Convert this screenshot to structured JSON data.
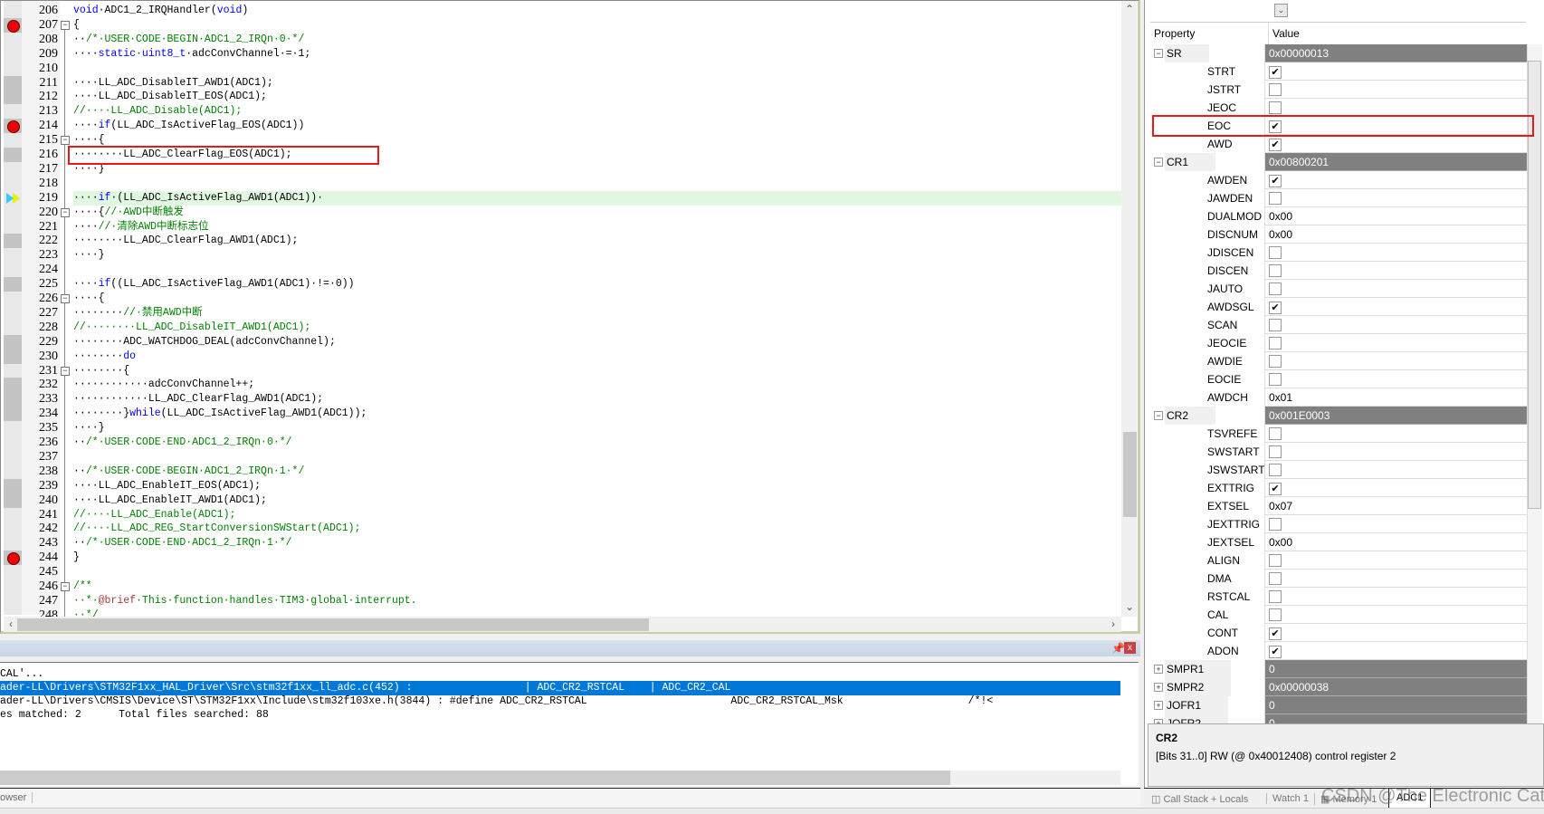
{
  "editor": {
    "current_line": 219,
    "lines": [
      {
        "n": "206",
        "mk": "",
        "fold": "",
        "seg": [
          [
            "k",
            "void"
          ],
          [
            "p",
            "·ADC1_2_IRQHandler("
          ],
          [
            "k",
            "void"
          ],
          [
            "p",
            ")"
          ]
        ]
      },
      {
        "n": "207",
        "mk": "bp",
        "fold": "minus",
        "seg": [
          [
            "p",
            "{"
          ]
        ]
      },
      {
        "n": "208",
        "mk": "",
        "fold": "",
        "seg": [
          [
            "p",
            "··"
          ],
          [
            "c",
            "/*·USER·CODE·BEGIN·ADC1_2_IRQn·0·*/"
          ]
        ]
      },
      {
        "n": "209",
        "mk": "",
        "fold": "",
        "seg": [
          [
            "p",
            "····"
          ],
          [
            "k",
            "static·uint8_t"
          ],
          [
            "p",
            "·adcConvChannel·=·1;"
          ]
        ]
      },
      {
        "n": "210",
        "mk": "",
        "fold": "",
        "seg": []
      },
      {
        "n": "211",
        "mk": "exec",
        "fold": "",
        "seg": [
          [
            "p",
            "····LL_ADC_DisableIT_AWD1(ADC1);"
          ]
        ]
      },
      {
        "n": "212",
        "mk": "exec",
        "fold": "",
        "seg": [
          [
            "p",
            "····LL_ADC_DisableIT_EOS(ADC1);"
          ]
        ]
      },
      {
        "n": "213",
        "mk": "",
        "fold": "",
        "seg": [
          [
            "c",
            "//····LL_ADC_Disable(ADC1);"
          ]
        ]
      },
      {
        "n": "214",
        "mk": "bp",
        "fold": "",
        "seg": [
          [
            "p",
            "····"
          ],
          [
            "k",
            "if"
          ],
          [
            "p",
            "(LL_ADC_IsActiveFlag_EOS(ADC1))"
          ]
        ]
      },
      {
        "n": "215",
        "mk": "",
        "fold": "minus",
        "seg": [
          [
            "p",
            "····{"
          ]
        ]
      },
      {
        "n": "216",
        "mk": "exec",
        "fold": "",
        "seg": [
          [
            "p",
            "········LL_ADC_ClearFlag_EOS(ADC1);"
          ]
        ]
      },
      {
        "n": "217",
        "mk": "",
        "fold": "",
        "seg": [
          [
            "p",
            "····}"
          ]
        ]
      },
      {
        "n": "218",
        "mk": "",
        "fold": "",
        "seg": []
      },
      {
        "n": "219",
        "mk": "cur",
        "fold": "",
        "seg": [
          [
            "p",
            "····"
          ],
          [
            "k",
            "if"
          ],
          [
            "p",
            "·(LL_ADC_IsActiveFlag_AWD1(ADC1))·"
          ]
        ]
      },
      {
        "n": "220",
        "mk": "",
        "fold": "minus",
        "seg": [
          [
            "p",
            "····{"
          ],
          [
            "c",
            "//·AWD中断触发"
          ]
        ]
      },
      {
        "n": "221",
        "mk": "",
        "fold": "",
        "seg": [
          [
            "p",
            "····"
          ],
          [
            "c",
            "//·清除AWD中断标志位"
          ]
        ]
      },
      {
        "n": "222",
        "mk": "exec",
        "fold": "",
        "seg": [
          [
            "p",
            "········LL_ADC_ClearFlag_AWD1(ADC1);"
          ]
        ]
      },
      {
        "n": "223",
        "mk": "",
        "fold": "",
        "seg": [
          [
            "p",
            "····}"
          ]
        ]
      },
      {
        "n": "224",
        "mk": "",
        "fold": "",
        "seg": []
      },
      {
        "n": "225",
        "mk": "exec",
        "fold": "",
        "seg": [
          [
            "p",
            "····"
          ],
          [
            "k",
            "if"
          ],
          [
            "p",
            "((LL_ADC_IsActiveFlag_AWD1(ADC1)·!=·0))"
          ]
        ]
      },
      {
        "n": "226",
        "mk": "",
        "fold": "minus",
        "seg": [
          [
            "p",
            "····{"
          ]
        ]
      },
      {
        "n": "227",
        "mk": "",
        "fold": "",
        "seg": [
          [
            "p",
            "········"
          ],
          [
            "c",
            "//·禁用AWD中断"
          ]
        ]
      },
      {
        "n": "228",
        "mk": "",
        "fold": "",
        "seg": [
          [
            "c",
            "//········LL_ADC_DisableIT_AWD1(ADC1);"
          ]
        ]
      },
      {
        "n": "229",
        "mk": "exec",
        "fold": "",
        "seg": [
          [
            "p",
            "········ADC_WATCHDOG_DEAL(adcConvChannel);"
          ]
        ]
      },
      {
        "n": "230",
        "mk": "exec",
        "fold": "",
        "seg": [
          [
            "p",
            "········"
          ],
          [
            "k",
            "do"
          ]
        ]
      },
      {
        "n": "231",
        "mk": "",
        "fold": "minus",
        "seg": [
          [
            "p",
            "········{"
          ]
        ]
      },
      {
        "n": "232",
        "mk": "exec",
        "fold": "",
        "seg": [
          [
            "p",
            "············adcConvChannel++;"
          ]
        ]
      },
      {
        "n": "233",
        "mk": "exec",
        "fold": "",
        "seg": [
          [
            "p",
            "············LL_ADC_ClearFlag_AWD1(ADC1);"
          ]
        ]
      },
      {
        "n": "234",
        "mk": "exec",
        "fold": "",
        "seg": [
          [
            "p",
            "········}"
          ],
          [
            "k",
            "while"
          ],
          [
            "p",
            "(LL_ADC_IsActiveFlag_AWD1(ADC1));"
          ]
        ]
      },
      {
        "n": "235",
        "mk": "",
        "fold": "",
        "seg": [
          [
            "p",
            "····}"
          ]
        ]
      },
      {
        "n": "236",
        "mk": "",
        "fold": "",
        "seg": [
          [
            "p",
            "··"
          ],
          [
            "c",
            "/*·USER·CODE·END·ADC1_2_IRQn·0·*/"
          ]
        ]
      },
      {
        "n": "237",
        "mk": "",
        "fold": "",
        "seg": []
      },
      {
        "n": "238",
        "mk": "",
        "fold": "",
        "seg": [
          [
            "p",
            "··"
          ],
          [
            "c",
            "/*·USER·CODE·BEGIN·ADC1_2_IRQn·1·*/"
          ]
        ]
      },
      {
        "n": "239",
        "mk": "exec",
        "fold": "",
        "seg": [
          [
            "p",
            "····LL_ADC_EnableIT_EOS(ADC1);"
          ]
        ]
      },
      {
        "n": "240",
        "mk": "exec",
        "fold": "",
        "seg": [
          [
            "p",
            "····LL_ADC_EnableIT_AWD1(ADC1);"
          ]
        ]
      },
      {
        "n": "241",
        "mk": "",
        "fold": "",
        "seg": [
          [
            "c",
            "//····LL_ADC_Enable(ADC1);"
          ]
        ]
      },
      {
        "n": "242",
        "mk": "",
        "fold": "",
        "seg": [
          [
            "c",
            "//····LL_ADC_REG_StartConversionSWStart(ADC1);"
          ]
        ]
      },
      {
        "n": "243",
        "mk": "",
        "fold": "",
        "seg": [
          [
            "p",
            "··"
          ],
          [
            "c",
            "/*·USER·CODE·END·ADC1_2_IRQn·1·*/"
          ]
        ]
      },
      {
        "n": "244",
        "mk": "bp",
        "fold": "",
        "seg": [
          [
            "p",
            "}"
          ]
        ]
      },
      {
        "n": "245",
        "mk": "",
        "fold": "",
        "seg": []
      },
      {
        "n": "246",
        "mk": "",
        "fold": "minus",
        "seg": [
          [
            "c",
            "/**"
          ]
        ]
      },
      {
        "n": "247",
        "mk": "",
        "fold": "",
        "seg": [
          [
            "c",
            "··*·"
          ],
          [
            "r",
            "@brief"
          ],
          [
            "c",
            "·This·function·handles·TIM3·global·interrupt."
          ]
        ]
      },
      {
        "n": "248",
        "mk": "",
        "fold": "",
        "seg": [
          [
            "c",
            "··*/"
          ]
        ]
      }
    ]
  },
  "output": {
    "lines": [
      {
        "text": "CAL'...",
        "selected": false
      },
      {
        "text": "ader-LL\\Drivers\\STM32F1xx_HAL_Driver\\Src\\stm32f1xx_ll_adc.c(452) :                  | ADC_CR2_RSTCAL    | ADC_CR2_CAL",
        "selected": true
      },
      {
        "text": "ader-LL\\Drivers\\CMSIS\\Device\\ST\\STM32F1xx\\Include\\stm32f103xe.h(3844) : #define ADC_CR2_RSTCAL                       ADC_CR2_RSTCAL_Msk                    /*!<",
        "selected": false
      },
      {
        "text": "es matched: 2      Total files searched: 88",
        "selected": false
      }
    ],
    "pin_icon": "pin-icon",
    "close_label": "x"
  },
  "left_tabs": {
    "partial_tab": "owser"
  },
  "registers": {
    "header": {
      "property": "Property",
      "value": "Value"
    },
    "rows": [
      {
        "name": "SR",
        "type": "group",
        "value": "0x00000013",
        "expanded": true
      },
      {
        "name": "STRT",
        "type": "check",
        "checked": true
      },
      {
        "name": "JSTRT",
        "type": "check",
        "checked": false
      },
      {
        "name": "JEOC",
        "type": "check",
        "checked": false
      },
      {
        "name": "EOC",
        "type": "check",
        "checked": true
      },
      {
        "name": "AWD",
        "type": "check",
        "checked": true
      },
      {
        "name": "CR1",
        "type": "group",
        "value": "0x00800201",
        "expanded": true
      },
      {
        "name": "AWDEN",
        "type": "check",
        "checked": true
      },
      {
        "name": "JAWDEN",
        "type": "check",
        "checked": false
      },
      {
        "name": "DUALMOD",
        "type": "text",
        "value": "0x00"
      },
      {
        "name": "DISCNUM",
        "type": "text",
        "value": "0x00"
      },
      {
        "name": "JDISCEN",
        "type": "check",
        "checked": false
      },
      {
        "name": "DISCEN",
        "type": "check",
        "checked": false
      },
      {
        "name": "JAUTO",
        "type": "check",
        "checked": false
      },
      {
        "name": "AWDSGL",
        "type": "check",
        "checked": true
      },
      {
        "name": "SCAN",
        "type": "check",
        "checked": false
      },
      {
        "name": "JEOCIE",
        "type": "check",
        "checked": false
      },
      {
        "name": "AWDIE",
        "type": "check",
        "checked": false
      },
      {
        "name": "EOCIE",
        "type": "check",
        "checked": false
      },
      {
        "name": "AWDCH",
        "type": "text",
        "value": "0x01"
      },
      {
        "name": "CR2",
        "type": "group",
        "value": "0x001E0003",
        "expanded": true
      },
      {
        "name": "TSVREFE",
        "type": "check",
        "checked": false
      },
      {
        "name": "SWSTART",
        "type": "check",
        "checked": false
      },
      {
        "name": "JSWSTART",
        "type": "check",
        "checked": false
      },
      {
        "name": "EXTTRIG",
        "type": "check",
        "checked": true
      },
      {
        "name": "EXTSEL",
        "type": "text",
        "value": "0x07"
      },
      {
        "name": "JEXTTRIG",
        "type": "check",
        "checked": false
      },
      {
        "name": "JEXTSEL",
        "type": "text",
        "value": "0x00"
      },
      {
        "name": "ALIGN",
        "type": "check",
        "checked": false
      },
      {
        "name": "DMA",
        "type": "check",
        "checked": false
      },
      {
        "name": "RSTCAL",
        "type": "check",
        "checked": false
      },
      {
        "name": "CAL",
        "type": "check",
        "checked": false
      },
      {
        "name": "CONT",
        "type": "check",
        "checked": true
      },
      {
        "name": "ADON",
        "type": "check",
        "checked": true
      },
      {
        "name": "SMPR1",
        "type": "group",
        "value": "0",
        "expanded": false
      },
      {
        "name": "SMPR2",
        "type": "group",
        "value": "0x00000038",
        "expanded": false
      },
      {
        "name": "JOFR1",
        "type": "group",
        "value": "0",
        "expanded": false
      },
      {
        "name": "JOFR2",
        "type": "group",
        "value": "0",
        "expanded": false
      }
    ],
    "info": {
      "title": "CR2",
      "description": "[Bits 31..0] RW (@ 0x40012408) control register 2"
    }
  },
  "right_tabs": [
    {
      "label": "Call Stack + Locals",
      "icon": "call-stack-icon"
    },
    {
      "label": "Watch 1"
    },
    {
      "label": "Memory 1",
      "icon": "memory-icon"
    },
    {
      "label": "ADC1",
      "active": true
    }
  ],
  "watermark": "CSDN @The Electronic Cat",
  "colors": {
    "keyword": "#0000ff",
    "comment": "#008000",
    "selection": "#0078d7",
    "current_line": "#e0f8e0",
    "annotation_box": "#e8191a",
    "register_group": "#808080"
  }
}
